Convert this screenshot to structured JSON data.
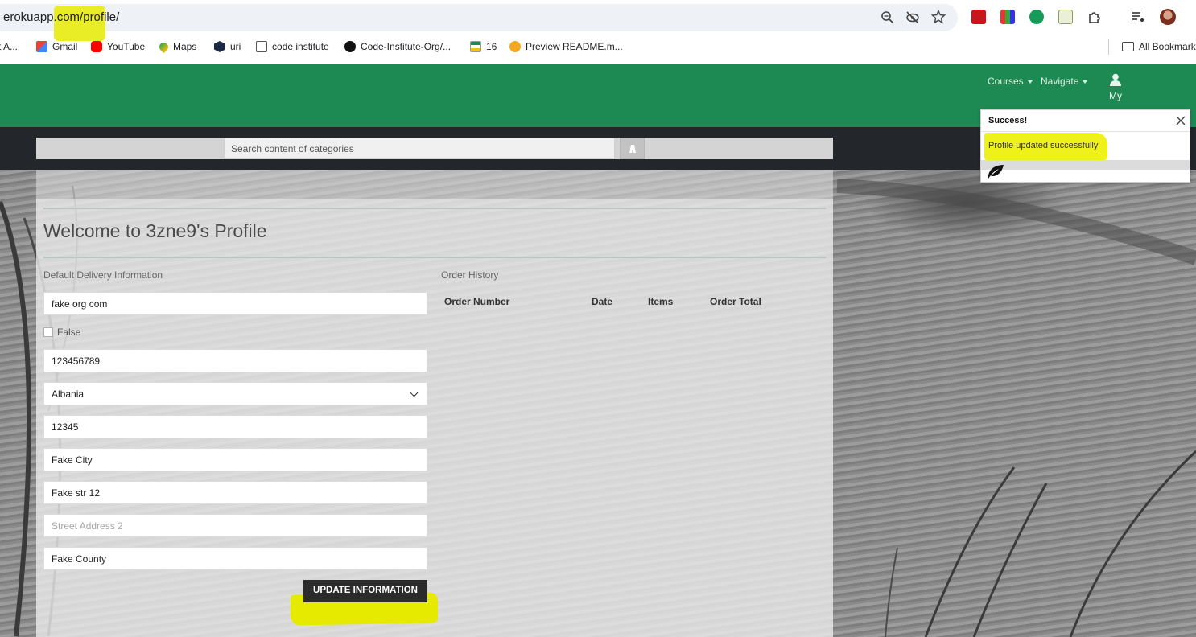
{
  "browser": {
    "url": "erokuapp.com/profile/",
    "bookmarks": [
      {
        "label": "t A...",
        "icon": "bookmark-icon"
      },
      {
        "label": "Gmail",
        "icon": "gmail-icon"
      },
      {
        "label": "YouTube",
        "icon": "youtube-icon"
      },
      {
        "label": "Maps",
        "icon": "maps-icon"
      },
      {
        "label": "uri",
        "icon": "uri-icon"
      },
      {
        "label": "code institute",
        "icon": "code-institute-icon"
      },
      {
        "label": "Code-Institute-Org/...",
        "icon": "github-icon"
      },
      {
        "label": "16",
        "icon": "flag-icon"
      },
      {
        "label": "Preview README.m...",
        "icon": "preview-icon"
      }
    ],
    "all_bookmarks": "All Bookmark"
  },
  "nav": {
    "courses": "Courses",
    "navigate": "Navigate",
    "my_account": "My"
  },
  "search": {
    "placeholder": "Search content of categories"
  },
  "profile": {
    "title": "Welcome to 3zne9's Profile",
    "delivery_label": "Default Delivery Information",
    "order_history_label": "Order History",
    "fields": {
      "name": "fake org com",
      "checkbox_label": "False",
      "phone": "123456789",
      "country": "Albania",
      "postcode": "12345",
      "city": "Fake City",
      "street1": "Fake str 12",
      "street2_placeholder": "Street Address 2",
      "county": "Fake County"
    },
    "order_columns": [
      "Order Number",
      "Date",
      "Items",
      "Order Total"
    ],
    "update_button": "UPDATE INFORMATION"
  },
  "toast": {
    "title": "Success!",
    "message": "Profile updated successfully"
  },
  "colors": {
    "header_green": "#1e8a53",
    "dark_bar": "#23262b",
    "highlight_yellow": "#e8ec1a"
  }
}
